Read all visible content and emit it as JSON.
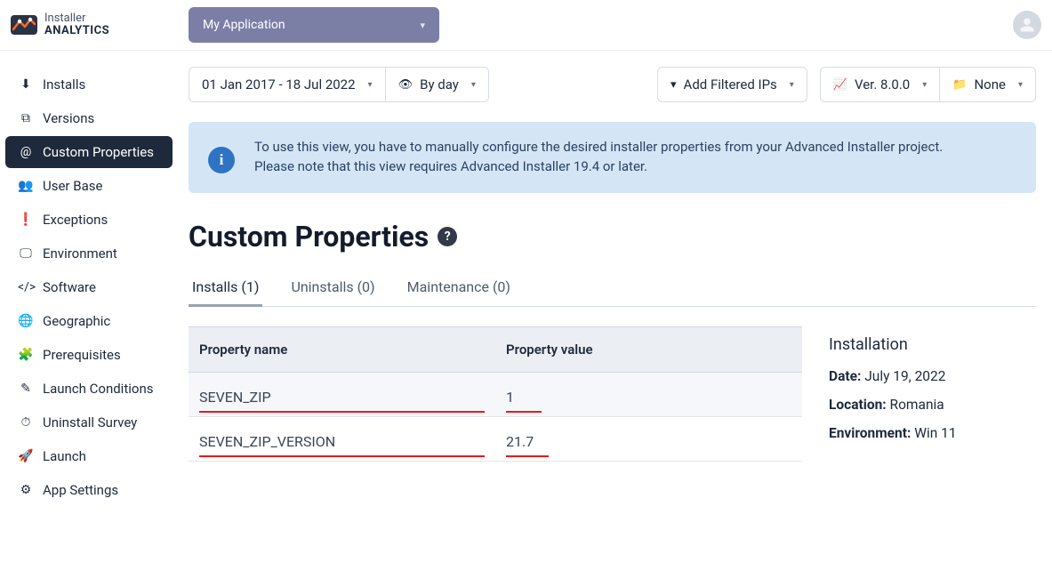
{
  "brand": {
    "line1": "Installer",
    "line2": "ANALYTICS"
  },
  "app_selector": {
    "label": "My Application"
  },
  "sidebar": {
    "items": [
      {
        "label": "Installs",
        "icon": "download"
      },
      {
        "label": "Versions",
        "icon": "copy"
      },
      {
        "label": "Custom Properties",
        "icon": "at",
        "active": true
      },
      {
        "label": "User Base",
        "icon": "users"
      },
      {
        "label": "Exceptions",
        "icon": "alert"
      },
      {
        "label": "Environment",
        "icon": "monitor"
      },
      {
        "label": "Software",
        "icon": "code"
      },
      {
        "label": "Geographic",
        "icon": "globe"
      },
      {
        "label": "Prerequisites",
        "icon": "puzzle"
      },
      {
        "label": "Launch Conditions",
        "icon": "edit"
      },
      {
        "label": "Uninstall Survey",
        "icon": "speed"
      },
      {
        "label": "Launch",
        "icon": "rocket"
      },
      {
        "label": "App Settings",
        "icon": "gear"
      }
    ]
  },
  "filters": {
    "date_range": "01 Jan 2017  -   18 Jul 2022",
    "granularity": "By day",
    "ips": "Add Filtered IPs",
    "version": "Ver. 8.0.0",
    "folder": "None"
  },
  "info": {
    "line1": "To use this view, you have to manually configure the desired installer properties from your Advanced Installer project.",
    "line2": "Please note that this view requires Advanced Installer 19.4 or later."
  },
  "page": {
    "title": "Custom Properties"
  },
  "tabs": [
    {
      "label": "Installs (1)",
      "active": true
    },
    {
      "label": "Uninstalls (0)"
    },
    {
      "label": "Maintenance (0)"
    }
  ],
  "table": {
    "headers": {
      "name": "Property name",
      "value": "Property value"
    },
    "rows": [
      {
        "name": "SEVEN_ZIP",
        "value": "1"
      },
      {
        "name": "SEVEN_ZIP_VERSION",
        "value": "21.7"
      }
    ]
  },
  "details": {
    "title": "Installation",
    "date_label": "Date:",
    "date_value": "July 19, 2022",
    "loc_label": "Location:",
    "loc_value": "Romania",
    "env_label": "Environment:",
    "env_value": "Win 11"
  }
}
